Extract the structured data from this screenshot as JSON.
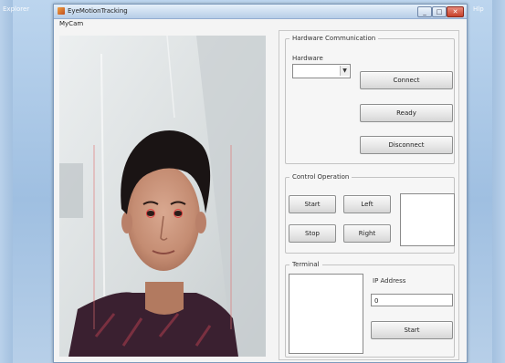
{
  "desktop": {
    "left_label": "Explorer",
    "right_label": "Hlp"
  },
  "window": {
    "title": "EyeMotionTracking",
    "controls": {
      "minimize": "_",
      "maximize": "□",
      "close": "✕"
    }
  },
  "camera": {
    "label": "MyCam"
  },
  "hardware_comm": {
    "title": "Hardware Communication",
    "port_label": "Hardware",
    "port_value": "",
    "connect": "Connect",
    "ready": "Ready",
    "disconnect": "Disconnect"
  },
  "control": {
    "title": "Control Operation",
    "start": "Start",
    "left": "Left",
    "stop": "Stop",
    "right": "Right"
  },
  "terminal": {
    "title": "Terminal",
    "ip_label": "IP Address",
    "ip_value": "0",
    "start": "Start"
  },
  "colors": {
    "desktop": "#a9c6e4",
    "window_frame": "#dde6f0",
    "close_button": "#c6402a"
  }
}
